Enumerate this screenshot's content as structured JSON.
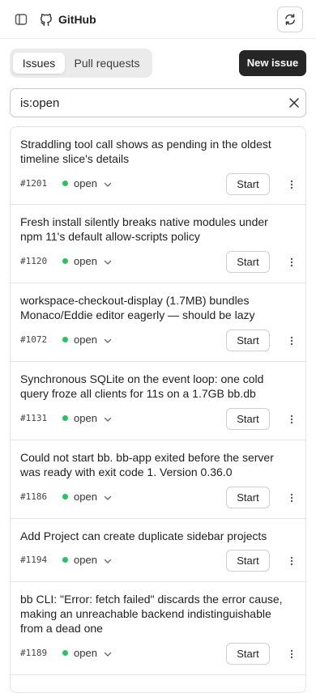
{
  "header": {
    "app_title": "GitHub"
  },
  "tabs": [
    {
      "label": "Issues",
      "active": true
    },
    {
      "label": "Pull requests",
      "active": false
    }
  ],
  "new_issue_label": "New issue",
  "search": {
    "value": "is:open"
  },
  "status_color": "#22c55e",
  "issues": [
    {
      "title": "Straddling tool call shows as pending in the oldest timeline slice's details",
      "number": "#1201",
      "status": "open",
      "action": "Start"
    },
    {
      "title": "Fresh install silently breaks native modules under npm 11's default allow-scripts policy",
      "number": "#1120",
      "status": "open",
      "action": "Start"
    },
    {
      "title": "workspace-checkout-display (1.7MB) bundles Monaco/Eddie editor eagerly — should be lazy",
      "number": "#1072",
      "status": "open",
      "action": "Start"
    },
    {
      "title": "Synchronous SQLite on the event loop: one cold query froze all clients for 11s on a 1.7GB bb.db",
      "number": "#1131",
      "status": "open",
      "action": "Start"
    },
    {
      "title": "Could not start bb. bb-app exited before the server was ready with exit code 1. Version 0.36.0",
      "number": "#1186",
      "status": "open",
      "action": "Start"
    },
    {
      "title": "Add Project can create duplicate sidebar projects",
      "number": "#1194",
      "status": "open",
      "action": "Start"
    },
    {
      "title": "bb CLI: \"Error: fetch failed\" discards the error cause, making an unreachable backend indistinguishable from a dead one",
      "number": "#1189",
      "status": "open",
      "action": "Start"
    }
  ]
}
